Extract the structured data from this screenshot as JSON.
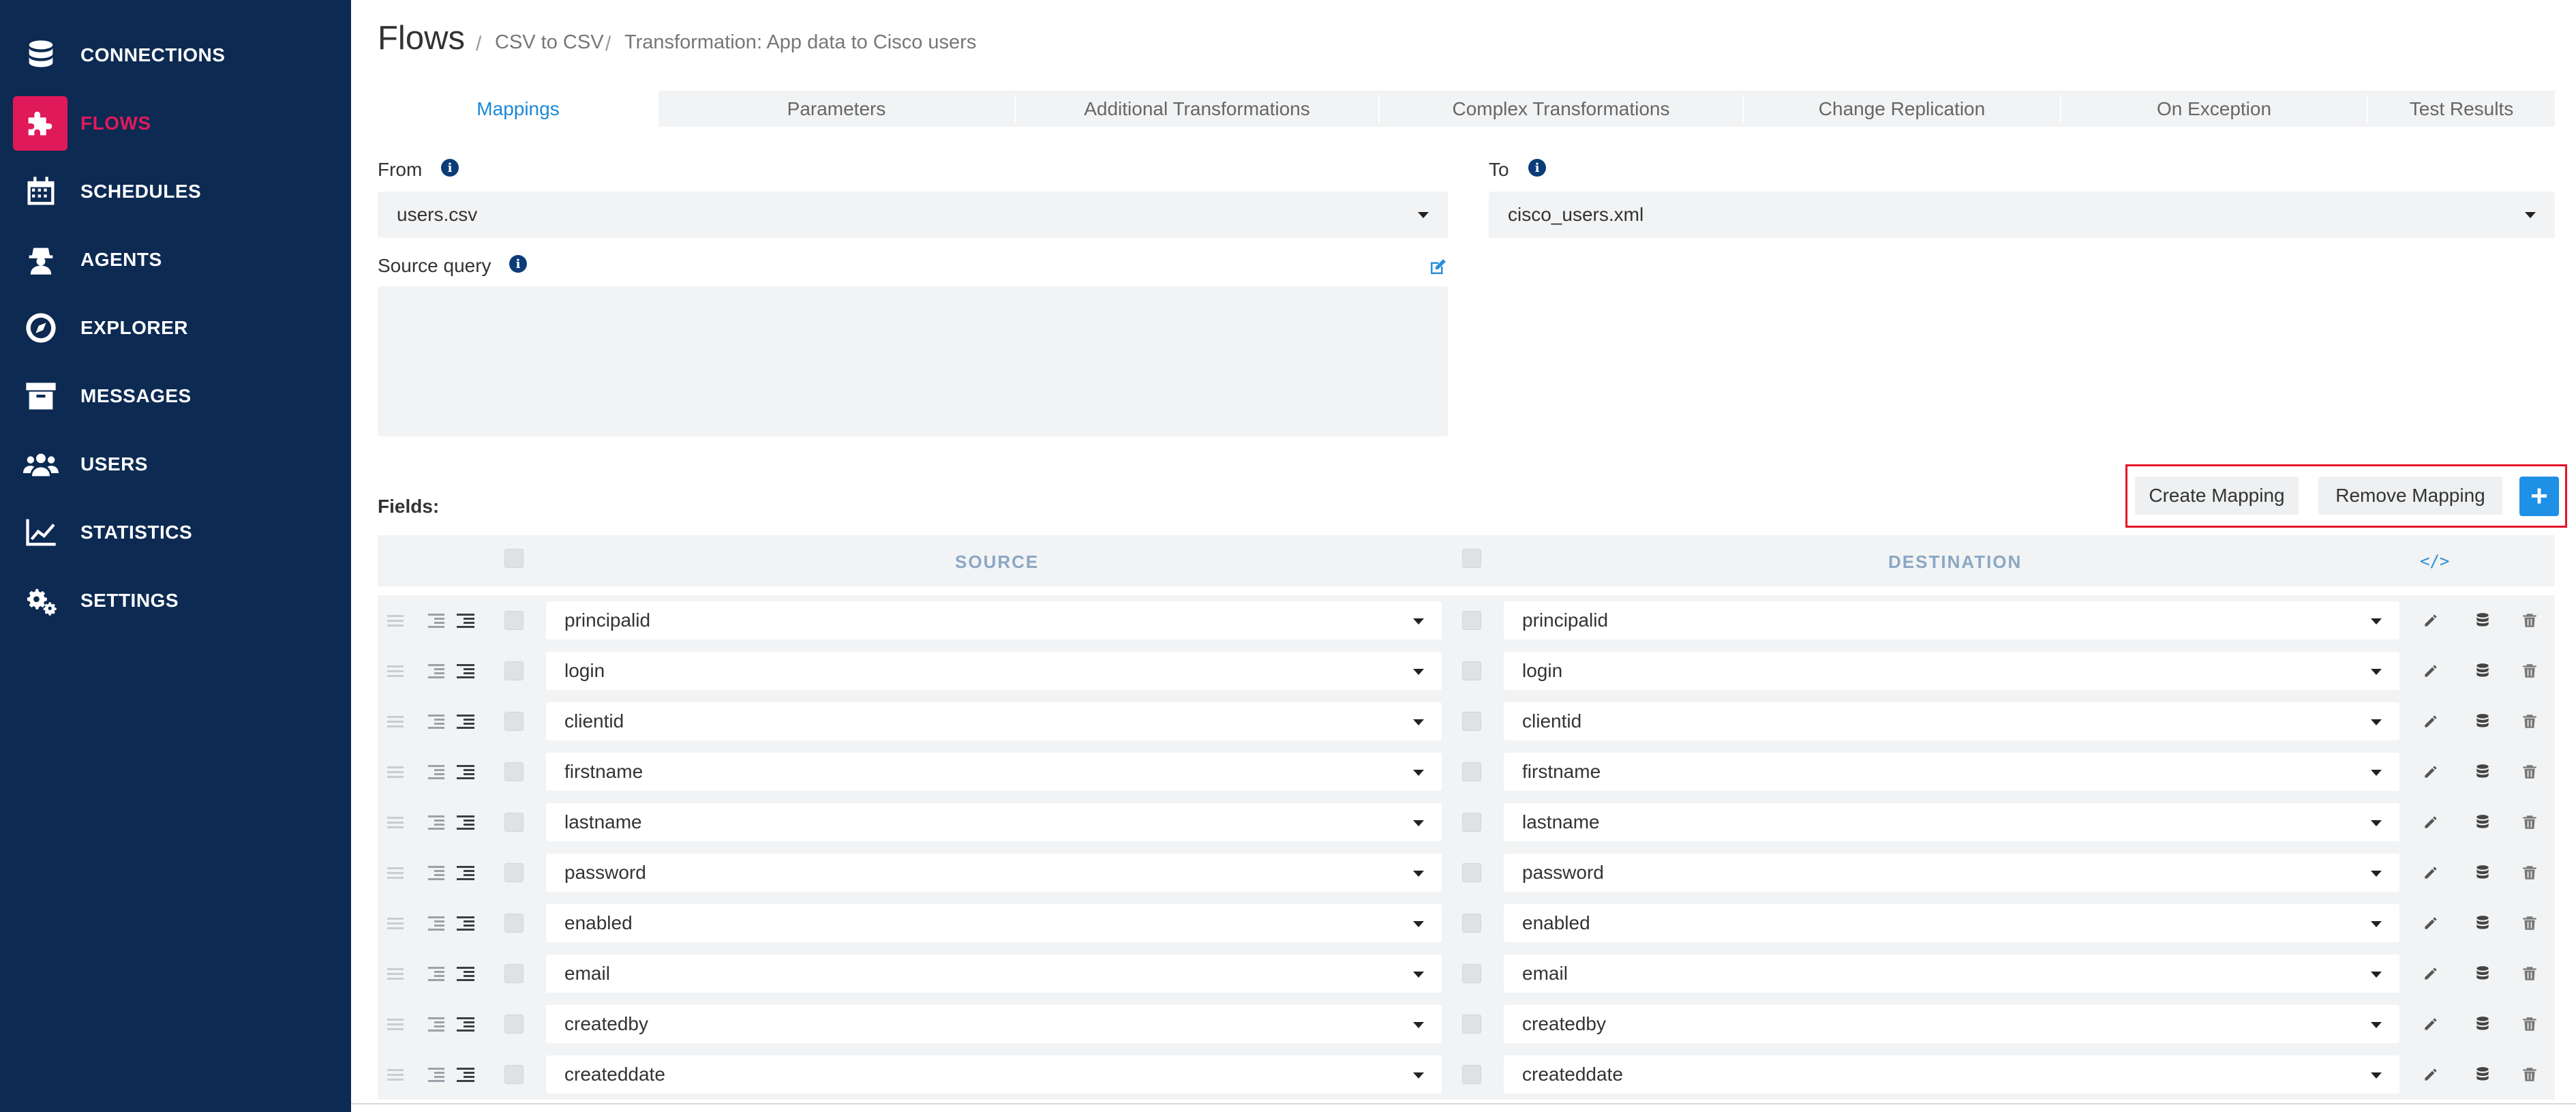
{
  "sidebar": {
    "items": [
      {
        "label": "CONNECTIONS",
        "icon": "database-icon"
      },
      {
        "label": "FLOWS",
        "icon": "puzzle-icon",
        "active": true
      },
      {
        "label": "SCHEDULES",
        "icon": "calendar-icon"
      },
      {
        "label": "AGENTS",
        "icon": "agent-icon"
      },
      {
        "label": "EXPLORER",
        "icon": "compass-icon"
      },
      {
        "label": "MESSAGES",
        "icon": "archive-icon"
      },
      {
        "label": "USERS",
        "icon": "users-icon"
      },
      {
        "label": "STATISTICS",
        "icon": "chart-icon"
      },
      {
        "label": "SETTINGS",
        "icon": "cogs-icon"
      }
    ],
    "accent_color": "#e0195a",
    "background_color": "#0c2a52"
  },
  "header": {
    "title": "Flows",
    "breadcrumbs": [
      "CSV to CSV",
      "Transformation: App data to Cisco users"
    ]
  },
  "tabs": [
    {
      "label": "Mappings",
      "active": true
    },
    {
      "label": "Parameters"
    },
    {
      "label": "Additional Transformations"
    },
    {
      "label": "Complex Transformations"
    },
    {
      "label": "Change Replication"
    },
    {
      "label": "On Exception"
    },
    {
      "label": "Test Results"
    }
  ],
  "from": {
    "label": "From",
    "value": "users.csv"
  },
  "to": {
    "label": "To",
    "value": "cisco_users.xml"
  },
  "source_query": {
    "label": "Source query",
    "value": ""
  },
  "fields": {
    "label": "Fields:",
    "create_mapping": "Create Mapping",
    "remove_mapping": "Remove Mapping",
    "add": "+",
    "source_header": "SOURCE",
    "destination_header": "DESTINATION",
    "code_toggle": "</>",
    "rows": [
      {
        "source": "principalid",
        "destination": "principalid"
      },
      {
        "source": "login",
        "destination": "login"
      },
      {
        "source": "clientid",
        "destination": "clientid"
      },
      {
        "source": "firstname",
        "destination": "firstname"
      },
      {
        "source": "lastname",
        "destination": "lastname"
      },
      {
        "source": "password",
        "destination": "password"
      },
      {
        "source": "enabled",
        "destination": "enabled"
      },
      {
        "source": "email",
        "destination": "email"
      },
      {
        "source": "createdby",
        "destination": "createdby"
      },
      {
        "source": "createddate",
        "destination": "createddate"
      }
    ]
  }
}
